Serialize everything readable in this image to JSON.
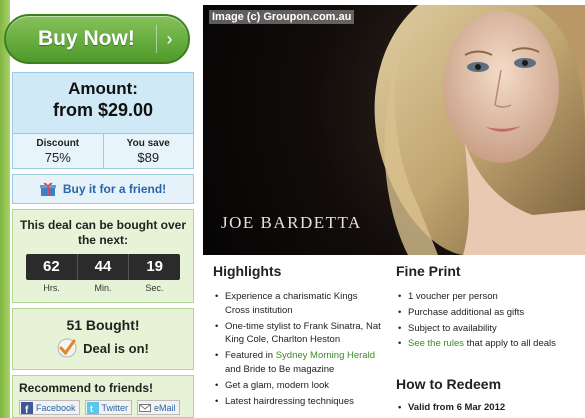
{
  "buy": {
    "label": "Buy Now!",
    "arrow": "›"
  },
  "amount": {
    "label": "Amount:",
    "value": "from $29.00"
  },
  "savings": {
    "discount_label": "Discount",
    "discount_value": "75%",
    "save_label": "You save",
    "save_value": "$89"
  },
  "gift": {
    "label": "Buy it for a friend!",
    "icon": "gift-icon"
  },
  "timer": {
    "title": "This deal can be bought over the next:",
    "hours": "62",
    "minutes": "44",
    "seconds": "19",
    "hours_unit": "Hrs.",
    "minutes_unit": "Min.",
    "seconds_unit": "Sec."
  },
  "bought": {
    "count": "51 Bought!",
    "status": "Deal is on!"
  },
  "recommend": {
    "title": "Recommend to friends!",
    "facebook": "Facebook",
    "twitter": "Twitter",
    "email": "eMail"
  },
  "hero": {
    "credit": "Image (c) Groupon.com.au",
    "name": "JOE BARDETTA"
  },
  "highlights": {
    "title": "Highlights",
    "items": [
      "Experience a charismatic Kings Cross institution",
      "One-time stylist to Frank Sinatra, Nat King Cole, Charlton Heston",
      "Featured in ",
      "Get a glam, modern look",
      "Latest hairdressing techniques"
    ],
    "featured_link": "Sydney Morning Herald",
    "featured_rest": " and Bride to Be magazine"
  },
  "fine_print": {
    "title": "Fine Print",
    "items": [
      "1 voucher per person",
      "Purchase additional as gifts",
      "Subject to availability",
      " that apply to all deals"
    ],
    "rules_link": "See the rules"
  },
  "redeem": {
    "title": "How to Redeem",
    "valid": "Valid from 6 Mar 2012"
  },
  "colors": {
    "accent_green": "#4e9a2a",
    "link_blue": "#2a66a8",
    "panel_blue": "#cfe9f6",
    "panel_green": "#e6f3d6"
  }
}
